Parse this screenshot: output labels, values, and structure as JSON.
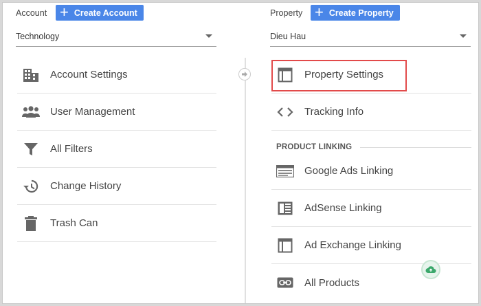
{
  "account": {
    "label": "Account",
    "create_label": "Create Account",
    "selected": "Technology",
    "items": [
      {
        "label": "Account Settings",
        "icon": "building-icon"
      },
      {
        "label": "User Management",
        "icon": "users-icon"
      },
      {
        "label": "All Filters",
        "icon": "filter-icon"
      },
      {
        "label": "Change History",
        "icon": "history-icon"
      },
      {
        "label": "Trash Can",
        "icon": "trash-icon"
      }
    ]
  },
  "property": {
    "label": "Property",
    "create_label": "Create Property",
    "selected": "Dieu Hau",
    "items": [
      {
        "label": "Property Settings",
        "icon": "window-icon"
      },
      {
        "label": "Tracking Info",
        "icon": "code-icon"
      }
    ],
    "section_heading": "PRODUCT LINKING",
    "linking_items": [
      {
        "label": "Google Ads Linking",
        "icon": "ads-icon"
      },
      {
        "label": "AdSense Linking",
        "icon": "adsense-icon"
      },
      {
        "label": "Ad Exchange Linking",
        "icon": "window-icon"
      },
      {
        "label": "All Products",
        "icon": "link-icon"
      }
    ]
  },
  "colors": {
    "accent": "#4a86e8",
    "highlight": "#e24a4a",
    "icon": "#666666"
  }
}
